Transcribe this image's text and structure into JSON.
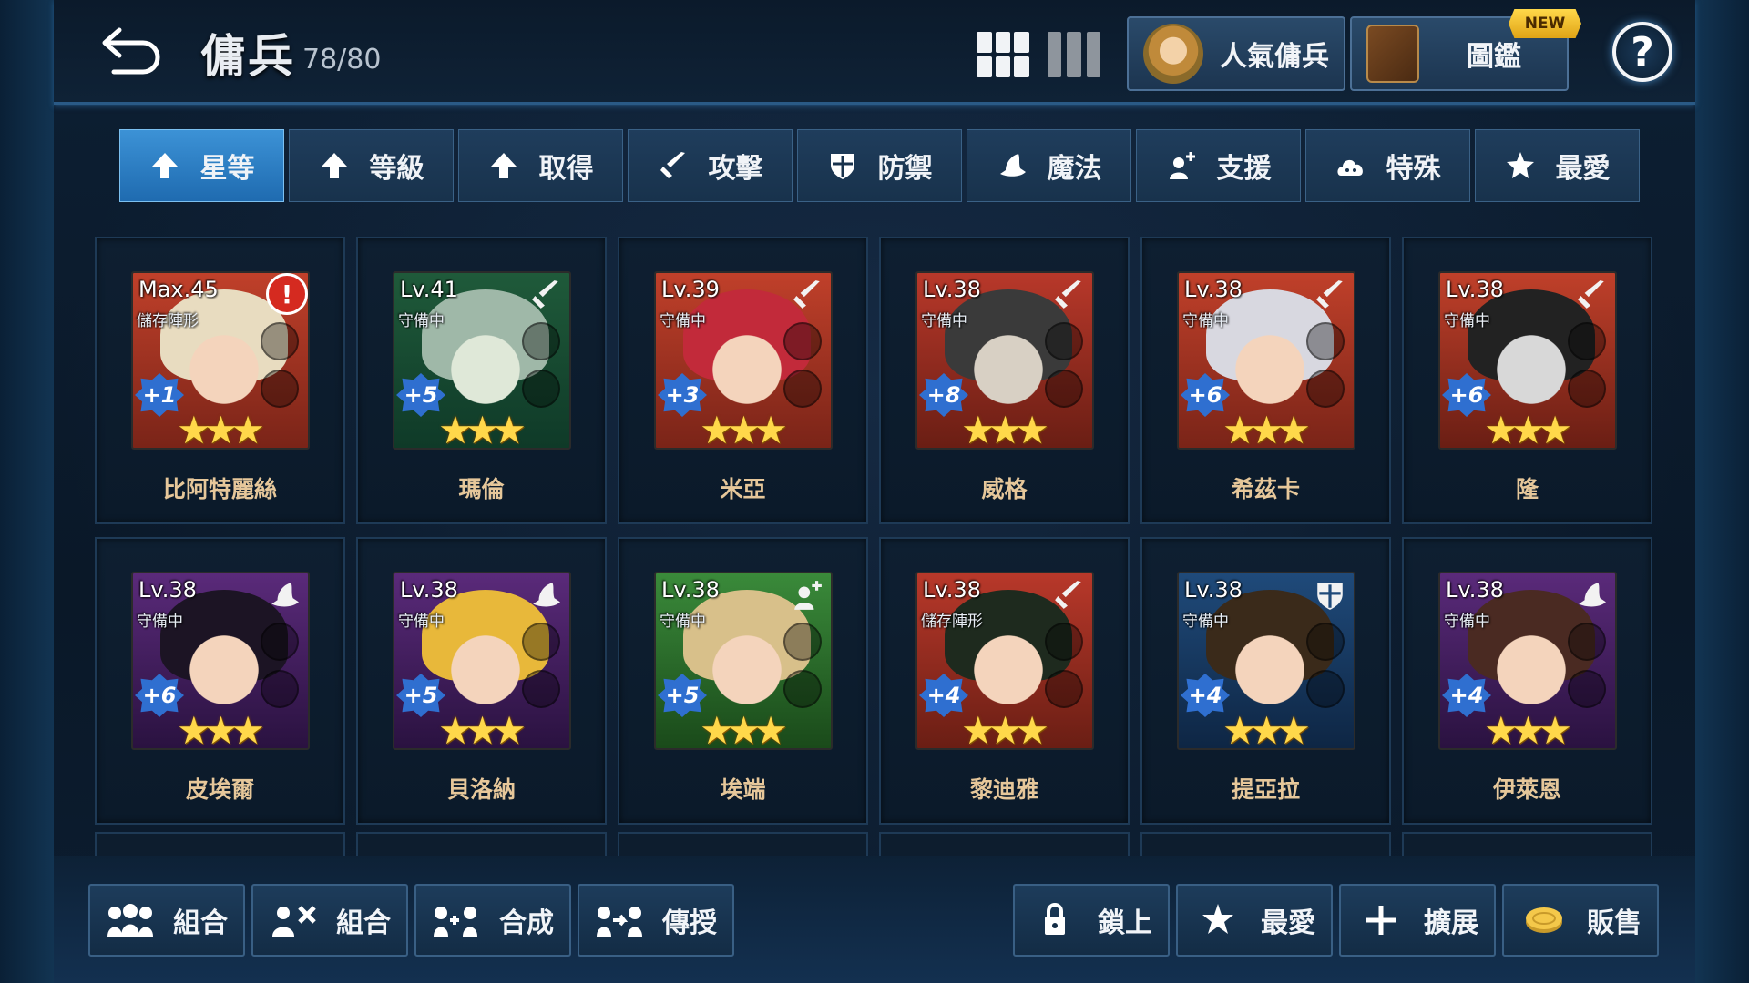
{
  "header": {
    "title": "傭兵",
    "count": "78/80",
    "popular_label": "人氣傭兵",
    "codex_label": "圖鑑",
    "new_badge": "NEW",
    "help_label": "?"
  },
  "tabs": [
    {
      "label": "星等",
      "icon": "arrow-up-icon",
      "active": true
    },
    {
      "label": "等級",
      "icon": "arrow-up-icon"
    },
    {
      "label": "取得",
      "icon": "arrow-up-icon"
    },
    {
      "label": "攻擊",
      "icon": "sword-icon"
    },
    {
      "label": "防禦",
      "icon": "shield-icon"
    },
    {
      "label": "魔法",
      "icon": "wizard-hat-icon"
    },
    {
      "label": "支援",
      "icon": "support-icon"
    },
    {
      "label": "特殊",
      "icon": "cloud-icon"
    },
    {
      "label": "最愛",
      "icon": "star-icon"
    }
  ],
  "mercenaries": [
    {
      "name": "比阿特麗絲",
      "level": "Max.45",
      "state": "儲存陣形",
      "plus": "+1",
      "stars": "★★★",
      "class_icon": "alert-icon",
      "alert": "!"
    },
    {
      "name": "瑪倫",
      "level": "Lv.41",
      "state": "守備中",
      "plus": "+5",
      "stars": "★★★",
      "class_icon": "sword-icon"
    },
    {
      "name": "米亞",
      "level": "Lv.39",
      "state": "守備中",
      "plus": "+3",
      "stars": "★★★",
      "class_icon": "sword-icon"
    },
    {
      "name": "威格",
      "level": "Lv.38",
      "state": "守備中",
      "plus": "+8",
      "stars": "★★★",
      "class_icon": "sword-icon"
    },
    {
      "name": "希茲卡",
      "level": "Lv.38",
      "state": "守備中",
      "plus": "+6",
      "stars": "★★★",
      "class_icon": "sword-icon"
    },
    {
      "name": "隆",
      "level": "Lv.38",
      "state": "守備中",
      "plus": "+6",
      "stars": "★★★",
      "class_icon": "sword-icon"
    },
    {
      "name": "皮埃爾",
      "level": "Lv.38",
      "state": "守備中",
      "plus": "+6",
      "stars": "★★★",
      "class_icon": "wizard-hat-icon"
    },
    {
      "name": "貝洛納",
      "level": "Lv.38",
      "state": "守備中",
      "plus": "+5",
      "stars": "★★★",
      "class_icon": "wizard-hat-icon"
    },
    {
      "name": "埃端",
      "level": "Lv.38",
      "state": "守備中",
      "plus": "+5",
      "stars": "★★★",
      "class_icon": "support-icon"
    },
    {
      "name": "黎迪雅",
      "level": "Lv.38",
      "state": "儲存陣形",
      "plus": "+4",
      "stars": "★★★",
      "class_icon": "sword-icon"
    },
    {
      "name": "提亞拉",
      "level": "Lv.38",
      "state": "守備中",
      "plus": "+4",
      "stars": "★★★",
      "class_icon": "shield-icon"
    },
    {
      "name": "伊萊恩",
      "level": "Lv.38",
      "state": "守備中",
      "plus": "+4",
      "stars": "★★★",
      "class_icon": "wizard-hat-icon"
    }
  ],
  "bottom": {
    "left": [
      {
        "label": "組合",
        "icon": "team-icon"
      },
      {
        "label": "組合",
        "icon": "puzzle-icon"
      },
      {
        "label": "合成",
        "icon": "merge-icon"
      },
      {
        "label": "傳授",
        "icon": "transfer-icon"
      }
    ],
    "right": [
      {
        "label": "鎖上",
        "icon": "lock-icon"
      },
      {
        "label": "最愛",
        "icon": "star-icon"
      },
      {
        "label": "擴展",
        "icon": "plus-icon"
      },
      {
        "label": "販售",
        "icon": "coin-icon"
      }
    ]
  },
  "colors": {
    "tab_active": "#2f80c8",
    "card_name": "#e6c79a",
    "star": "#ffd84a",
    "plus_badge": "#2f6fd0"
  }
}
